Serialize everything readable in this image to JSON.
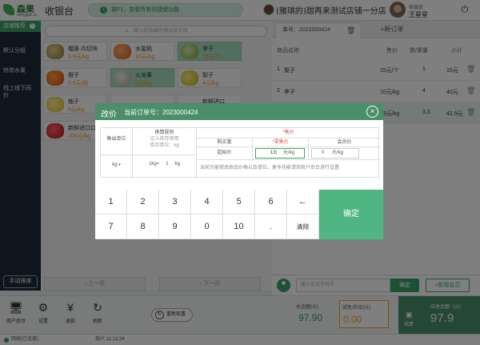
{
  "header": {
    "logo_text": "森果",
    "logo_sub": "sengguo.cc",
    "app_title": "收银台",
    "hint": "按F1，查看所有快捷键功能",
    "store_name": "(雅琪的)甜再来测试店铺一分店",
    "cashier_label": "收银员",
    "cashier_name": "王星星"
  },
  "sidebar": {
    "items": [
      {
        "label": "店铺推荐",
        "badge": "5"
      },
      {
        "label": "默认分组"
      },
      {
        "label": "热带水果"
      },
      {
        "label": "线上线下同价"
      }
    ],
    "sort_button": "手动排序"
  },
  "products": {
    "search_placeholder": "输入商品编码/商品名字母",
    "items": [
      {
        "name": "榴莲 内切块",
        "price": "9.9元/kg"
      },
      {
        "name": "水蜜桃",
        "price": "10元/kg"
      },
      {
        "name": "李子",
        "price": "15元/个"
      },
      {
        "name": "橙子",
        "price": "0.5元/份"
      },
      {
        "name": "火龙果",
        "price": "5元/kg"
      },
      {
        "name": "梨子",
        "price": "4元/kg"
      },
      {
        "name": "柚子",
        "price": "6元/kg"
      },
      {
        "name": "",
        "price": ""
      },
      {
        "name": "新鲜进口",
        "price": ""
      },
      {
        "name": "新鲜进口口",
        "price": "200元/kg"
      }
    ],
    "prev_page": "上一页",
    "next_page": "下一页"
  },
  "order": {
    "tab_label": "单号：2023000424",
    "new_tab": "+新订单",
    "columns": [
      "商品名称",
      "售价",
      "数/重量",
      "小计"
    ],
    "rows": [
      {
        "index": "1",
        "name": "梨子",
        "price": "15元/个",
        "qty": "1",
        "subtotal": "15元"
      },
      {
        "index": "2",
        "name": "李子",
        "price": "10元/kg",
        "qty": "4",
        "subtotal": "40元"
      },
      {
        "index": "3",
        "name": "",
        "price": "13元/kg",
        "qty": "3.3",
        "subtotal": "42.9元"
      }
    ]
  },
  "member": {
    "placeholder": "输入会员手机号",
    "confirm": "确定",
    "add": "+新增会员"
  },
  "toolbar": {
    "items": [
      {
        "label": "商户后台",
        "icon": "monitor-icon"
      },
      {
        "label": "设置",
        "icon": "gear-icon"
      },
      {
        "label": "退款",
        "icon": "refund-icon"
      },
      {
        "label": "刷新",
        "icon": "refresh-icon"
      }
    ],
    "register_button": "重新取重"
  },
  "totals": {
    "total_label": "总金额(元)",
    "total_value": "97.90",
    "discount_label": "减免/折扣(元)",
    "discount_value": "0.00",
    "pay_label": "应收金额（元）",
    "pay_value": "97.9",
    "pay_button": "结算"
  },
  "status": {
    "network": "网络(已连接)",
    "clock": "周六 11:13:34"
  },
  "dialog": {
    "title": "改价",
    "order_no": "当前订单号：2023000424",
    "col_unit": "售出单位",
    "col_rule": "换算规则",
    "rule_sub": "记入库存使用",
    "rule_sub2": "库存单位：kg",
    "col_price": "*售价",
    "col_qty": "购买量",
    "col_retail": "*零售价",
    "col_member": "会员价",
    "unit_value": "kg",
    "rule_left": "1kg=",
    "rule_num": "1",
    "rule_unit": "kg",
    "qty_value": "起始价",
    "retail_value": "13",
    "retail_unit": "元/kg",
    "member_value": "0",
    "member_unit": "元/kg",
    "note": "当前只能修改商品价格以及单位，更多功能请到商户后台进行设置",
    "keys": [
      "1",
      "2",
      "3",
      "4",
      "5",
      "6",
      "←",
      "7",
      "8",
      "9",
      "0",
      "10",
      ".",
      "清除"
    ],
    "confirm": "确定"
  },
  "colors": {
    "brand_green": "#4a8f6a",
    "accent_green": "#3aa36c",
    "price_orange": "#f08c1a",
    "sidebar_dark": "#1d2a38"
  }
}
